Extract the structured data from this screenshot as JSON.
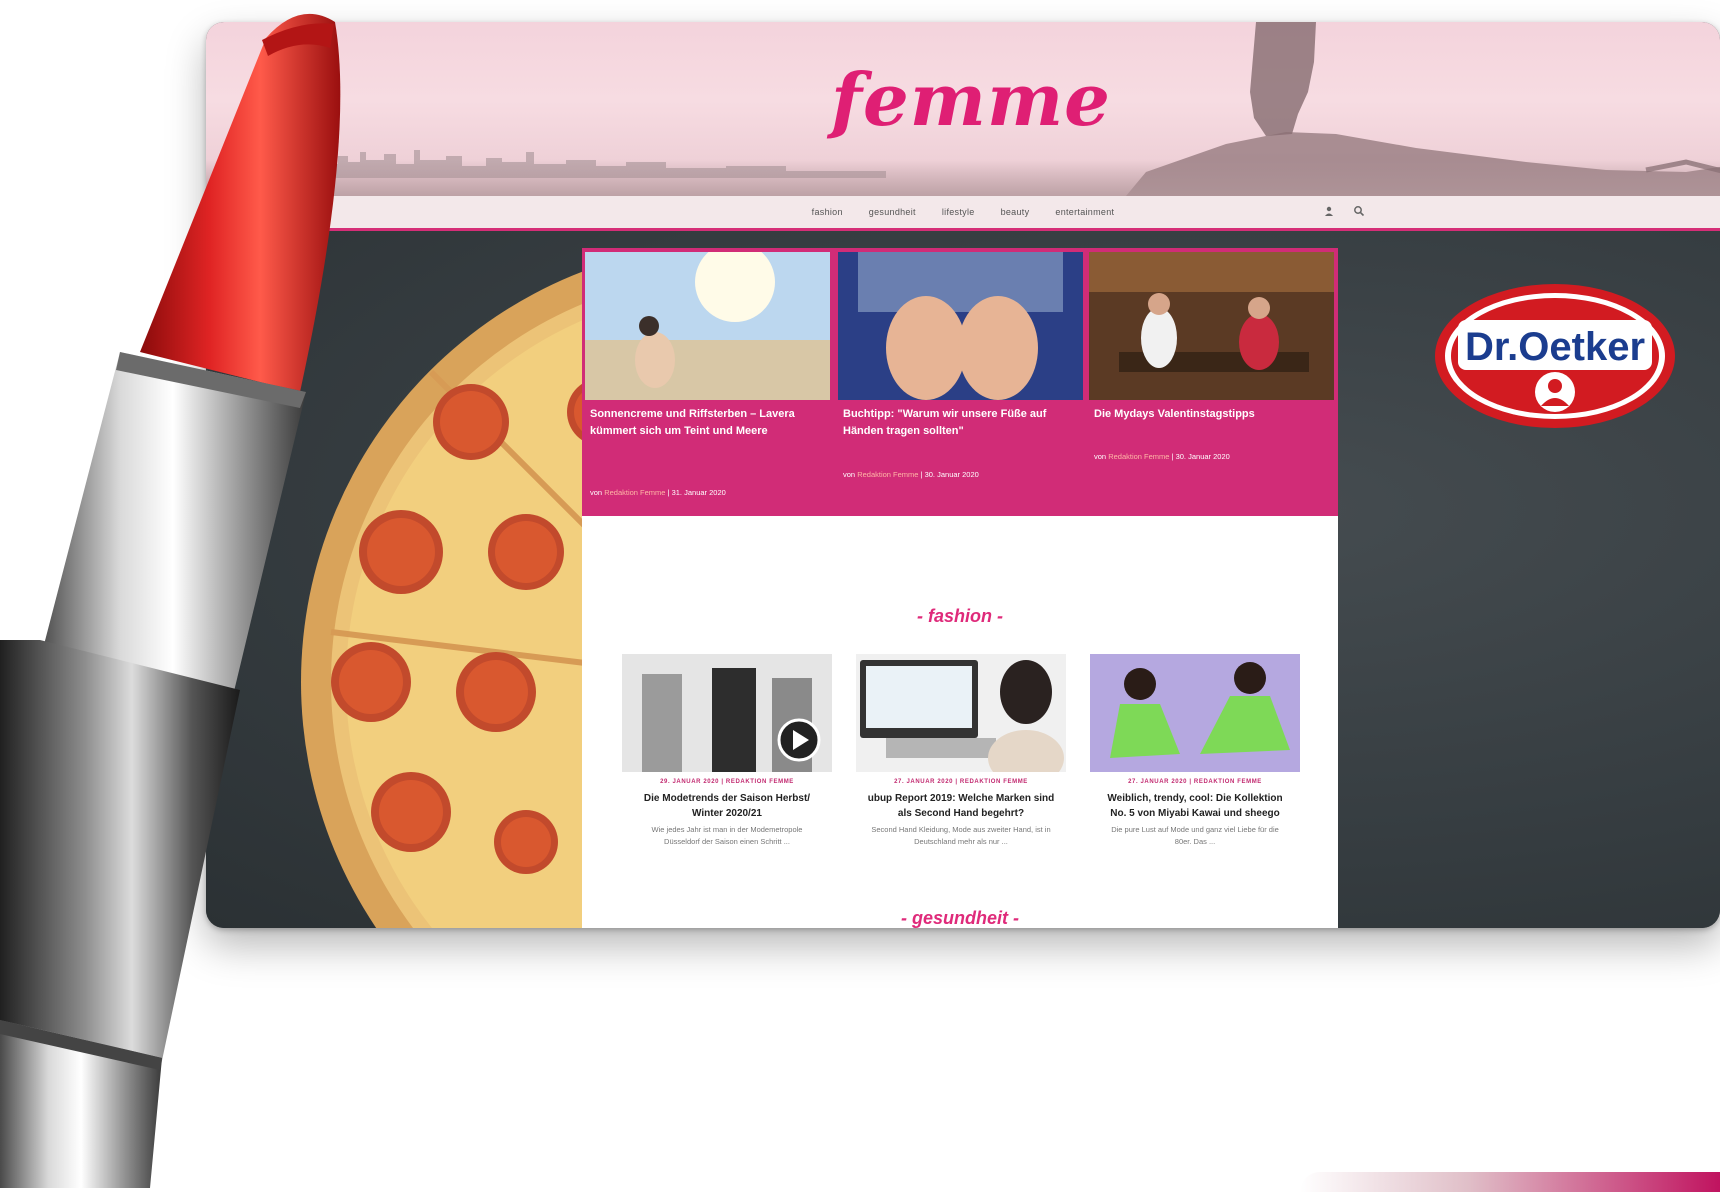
{
  "site": {
    "logo": "femme",
    "nav": [
      "fashion",
      "gesundheit",
      "lifestyle",
      "beauty",
      "entertainment"
    ],
    "nav_icons": [
      "user-icon",
      "search-icon"
    ]
  },
  "ad": {
    "brand": "Dr.Oetker",
    "colors": {
      "red": "#d21b21",
      "blue": "#1b3d8f"
    }
  },
  "featured": [
    {
      "title": "Sonnencreme und Riffsterben – Lavera kümmert sich um Teint und Meere",
      "meta_by": "von",
      "author": "Redaktion Femme",
      "date": "| 31. Januar 2020"
    },
    {
      "title": "Buchtipp: \"Warum wir unsere Füße auf Händen tragen sollten\"",
      "meta_by": "von",
      "author": "Redaktion Femme",
      "date": "| 30. Januar 2020"
    },
    {
      "title": "Die Mydays Valentinstagstipps",
      "meta_by": "von",
      "author": "Redaktion Femme",
      "date": "| 30. Januar 2020"
    }
  ],
  "sections": {
    "fashion": {
      "title": "- fashion -",
      "posts": [
        {
          "meta": "29. JANUAR 2020 | REDAKTION FEMME",
          "title": "Die Modetrends der Saison Herbst/ Winter 2020/21",
          "excerpt": "Wie jedes Jahr ist man in der Modemetropole Düsseldorf der Saison einen Schritt ..."
        },
        {
          "meta": "27. JANUAR 2020 | REDAKTION FEMME",
          "title": "ubup Report 2019: Welche Marken sind als Second Hand begehrt?",
          "excerpt": "Second Hand Kleidung, Mode aus zweiter Hand, ist in Deutschland mehr als nur ..."
        },
        {
          "meta": "27. JANUAR 2020 | REDAKTION FEMME",
          "title": "Weiblich, trendy, cool: Die Kollektion No. 5 von Miyabi Kawai und sheego",
          "excerpt": "Die pure Lust auf Mode und ganz viel Liebe für die 80er. Das ..."
        }
      ]
    },
    "gesundheit": {
      "title": "- gesundheit -"
    }
  },
  "colors": {
    "brand_pink": "#df1f74",
    "featured_bg": "#d12c77"
  }
}
